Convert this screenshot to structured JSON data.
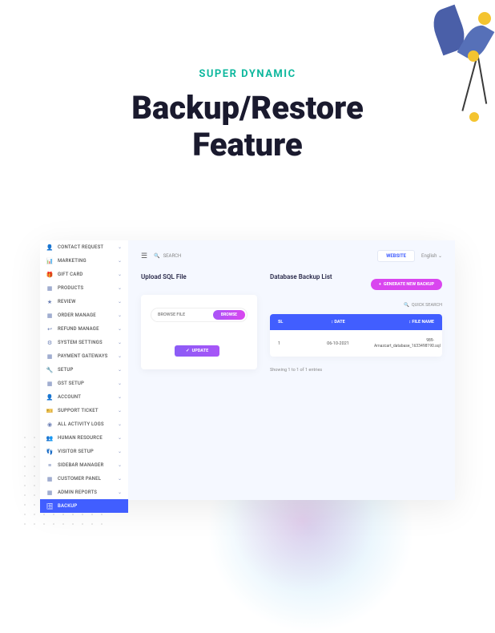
{
  "header": {
    "subtitle": "SUPER DYNAMIC",
    "title_line1": "Backup/Restore",
    "title_line2": "Feature"
  },
  "sidebar": {
    "items": [
      {
        "icon": "👤",
        "label": "CONTACT REQUEST"
      },
      {
        "icon": "📊",
        "label": "MARKETING"
      },
      {
        "icon": "🎁",
        "label": "GIFT CARD"
      },
      {
        "icon": "▦",
        "label": "PRODUCTS"
      },
      {
        "icon": "★",
        "label": "REVIEW"
      },
      {
        "icon": "▦",
        "label": "ORDER MANAGE"
      },
      {
        "icon": "↩",
        "label": "REFUND MANAGE"
      },
      {
        "icon": "⚙",
        "label": "SYSTEM SETTINGS"
      },
      {
        "icon": "▦",
        "label": "PAYMENT GATEWAYS"
      },
      {
        "icon": "🔧",
        "label": "SETUP"
      },
      {
        "icon": "▦",
        "label": "GST SETUP"
      },
      {
        "icon": "👤",
        "label": "ACCOUNT"
      },
      {
        "icon": "🎫",
        "label": "SUPPORT TICKET"
      },
      {
        "icon": "◉",
        "label": "ALL ACTIVITY LOGS"
      },
      {
        "icon": "👥",
        "label": "HUMAN RESOURCE"
      },
      {
        "icon": "👣",
        "label": "VISITOR SETUP"
      },
      {
        "icon": "≡",
        "label": "SIDEBAR MANAGER"
      },
      {
        "icon": "▦",
        "label": "CUSTOMER PANEL"
      },
      {
        "icon": "▦",
        "label": "ADMIN REPORTS"
      },
      {
        "icon": "🗄",
        "label": "BACKUP"
      }
    ]
  },
  "topbar": {
    "search_label": "SEARCH",
    "website_btn": "WEBSITE",
    "lang": "English"
  },
  "upload": {
    "title": "Upload SQL File",
    "browse_label": "BROWSE FILE",
    "browse_btn": "BROWSE",
    "update_btn": "UPDATE"
  },
  "backup": {
    "title": "Database Backup List",
    "generate_btn": "GENERATE NEW BACKUP",
    "quick_search": "QUICK SEARCH",
    "cols": {
      "sl": "SL",
      "date": "DATE",
      "file": "FILE NAME"
    },
    "rows": [
      {
        "sl": "1",
        "date": "06-10-2021",
        "file": "989-Amazcart_database_1633498190.sql"
      }
    ],
    "entries": "Showing 1 to 1 of 1 entries"
  }
}
